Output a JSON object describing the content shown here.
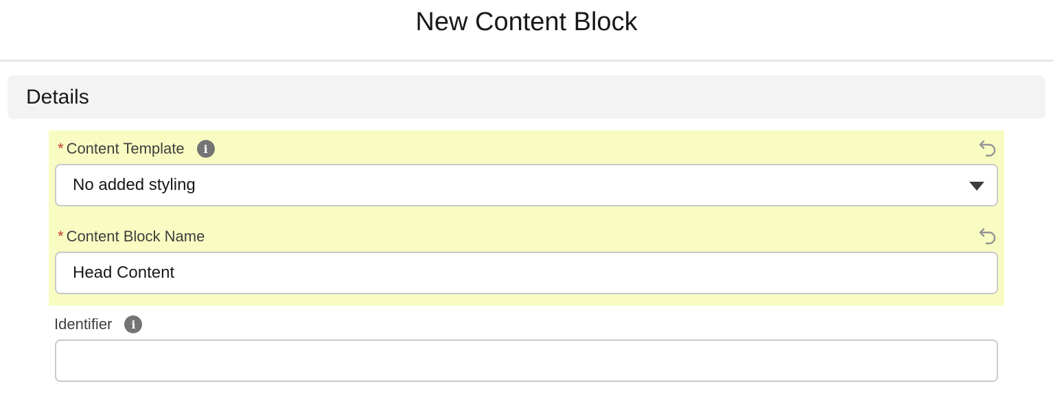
{
  "modal": {
    "title": "New Content Block"
  },
  "section": {
    "title": "Details"
  },
  "fields": {
    "content_template": {
      "label": "Content Template",
      "required_marker": "*",
      "value": "No added styling",
      "info_icon_glyph": "i"
    },
    "content_block_name": {
      "label": "Content Block Name",
      "required_marker": "*",
      "value": "Head Content"
    },
    "identifier": {
      "label": "Identifier",
      "value": "",
      "info_icon_glyph": "i"
    }
  },
  "icons": {
    "info": "info-icon",
    "undo": "undo-icon",
    "dropdown": "chevron-down-icon"
  },
  "colors": {
    "highlight": "#f9fcc2",
    "required": "#c23934",
    "section_bg": "#f3f3f3",
    "border": "#c9c9c9"
  }
}
